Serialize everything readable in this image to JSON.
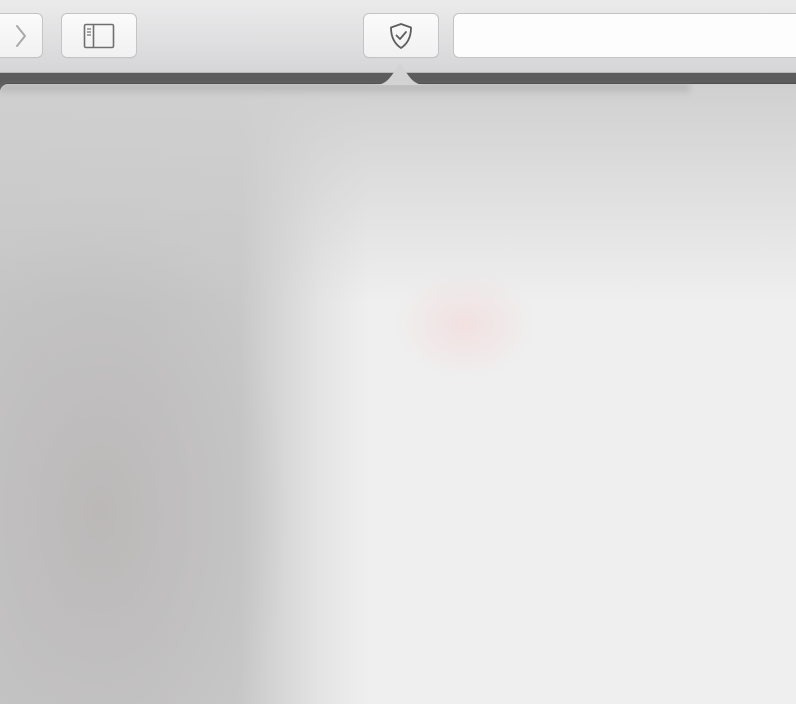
{
  "toolbar": {
    "forward_button": {
      "icon": "chevron-right-icon"
    },
    "sidebar_button": {
      "icon": "sidebar-icon"
    },
    "privacy_button": {
      "icon": "shield-check-icon"
    },
    "address_bar": {
      "value": "",
      "placeholder": ""
    }
  },
  "colors": {
    "toolbar_bg": "#e3e2e4",
    "button_bg": "#f7f7f7",
    "icon": "#6f6f6f",
    "strip": "#5c5c5c",
    "popover_bg": "#efefef"
  }
}
